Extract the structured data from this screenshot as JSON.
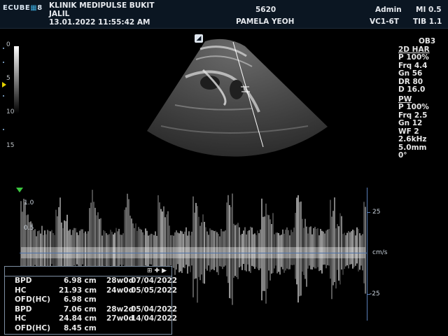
{
  "header": {
    "logo": "ECUBE",
    "logo_suffix": "8",
    "clinic_line1": "KLINIK MEDIPULSE BUKIT",
    "clinic_line2": "JALIL",
    "date": "13.01.2022",
    "time": "11:55:42  AM",
    "patient_id": "5620",
    "patient_name": "PAMELA YEOH",
    "user": "Admin",
    "probe": "VC1-6T",
    "mi": "MI 0.5",
    "tib": "TIB 1.1"
  },
  "depth_scale": {
    "ticks": [
      "0",
      "5",
      "10",
      "15"
    ]
  },
  "preset": "OB3",
  "mode_2d": {
    "title": "2D HAR",
    "params": [
      "P 100%",
      "Frq 4.4",
      "Gn 56",
      "DR 80",
      "D 16.0"
    ]
  },
  "mode_pw": {
    "title": "PW",
    "params": [
      "P 100%",
      "Frq 2.5",
      "Gn 12",
      "WF 2",
      "2.6kHz",
      "5.0mm",
      "0°"
    ]
  },
  "doppler": {
    "velocity_unit": "cm/s",
    "velocity_ticks": [
      "25",
      "-25"
    ],
    "time_ticks": [
      "1.0",
      "0.5"
    ]
  },
  "measurements": {
    "rows": [
      {
        "label": "BPD",
        "value": "6.98 cm",
        "ga": "28w0d",
        "edd": "07/04/2022"
      },
      {
        "label": "HC",
        "value": "21.93 cm",
        "ga": "24w0d",
        "edd": "05/05/2022"
      },
      {
        "label": "OFD(HC)",
        "value": "6.98 cm",
        "ga": "",
        "edd": ""
      },
      {
        "label": "BPD",
        "value": "7.06 cm",
        "ga": "28w2d",
        "edd": "05/04/2022"
      },
      {
        "label": "HC",
        "value": "24.84 cm",
        "ga": "27w0d",
        "edd": "14/04/2022"
      },
      {
        "label": "OFD(HC)",
        "value": "8.45 cm",
        "ga": "",
        "edd": ""
      }
    ]
  },
  "colors": {
    "header_bg": "#0b1622",
    "accent": "#3aa6d8",
    "scale_line": "#5a7fb8"
  }
}
